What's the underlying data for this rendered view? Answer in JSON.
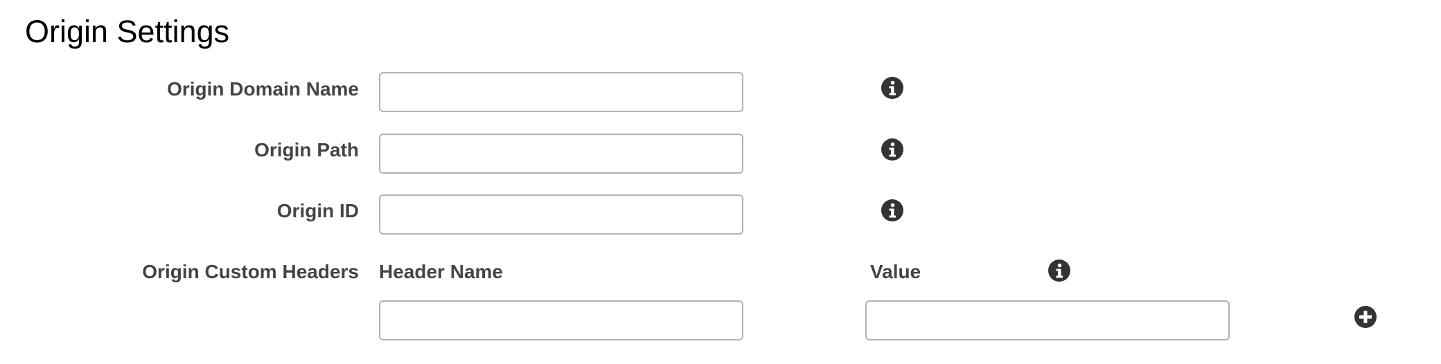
{
  "section": {
    "title": "Origin Settings"
  },
  "fields": [
    {
      "label": "Origin Domain Name",
      "value": "",
      "placeholder": "",
      "info_icon": "info-icon"
    },
    {
      "label": "Origin Path",
      "value": "",
      "placeholder": "",
      "info_icon": "info-icon"
    },
    {
      "label": "Origin ID",
      "value": "",
      "placeholder": "",
      "info_icon": "info-icon"
    }
  ],
  "custom_headers": {
    "label": "Origin Custom Headers",
    "name_header": "Header Name",
    "value_header": "Value",
    "info_icon": "info-icon",
    "add_icon": "plus-circle-icon",
    "rows": [
      {
        "name": "",
        "value": ""
      }
    ]
  },
  "colors": {
    "text": "#444444",
    "title": "#000000",
    "icon": "#333333",
    "input_border": "#b3b3b3"
  }
}
